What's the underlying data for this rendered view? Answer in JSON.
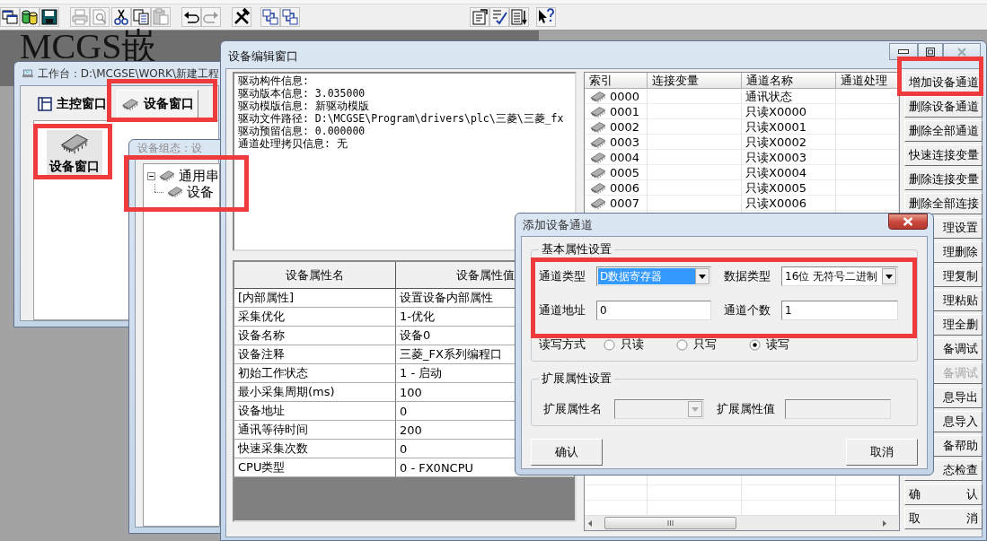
{
  "toolbar": [
    {
      "disabled": false
    },
    {
      "disabled": false
    },
    {
      "disabled": false
    },
    {
      "disabled": true
    },
    {
      "disabled": true
    },
    {
      "disabled": false
    },
    {
      "disabled": false
    },
    {
      "disabled": true
    },
    {
      "disabled": false
    },
    {
      "disabled": true
    },
    {
      "disabled": false
    },
    {
      "disabled": false
    },
    {
      "disabled": false
    },
    {
      "disabled": false
    },
    {
      "disabled": false
    },
    {
      "disabled": false
    },
    {
      "disabled": false
    }
  ],
  "banner": {
    "title": "MCGS嵌"
  },
  "workbench": {
    "title": "工作台：D:\\MCGSE\\WORK\\新建工程",
    "tabs": [
      {
        "label": "主控窗口",
        "selected": false
      },
      {
        "label": "设备窗口",
        "selected": true
      }
    ],
    "items": [
      {
        "label": "设备窗口",
        "selected": true
      }
    ]
  },
  "device_config_window": {
    "title": "设备组态：设",
    "tree": [
      {
        "label": "通用串",
        "expanded": true,
        "children": [
          {
            "label": "设备"
          }
        ]
      }
    ]
  },
  "device_edit_window": {
    "title": "设备编辑窗口",
    "info_lines": [
      "驱动构件信息:",
      "驱动版本信息: 3.035000",
      "驱动模版信息: 新驱动模版",
      "驱动文件路径: D:\\MCGSE\\Program\\drivers\\plc\\三菱\\三菱_fx",
      "驱动预留信息: 0.000000",
      "通道处理拷贝信息: 无"
    ],
    "properties": {
      "columns": [
        "设备属性名",
        "设备属性值"
      ],
      "rows": [
        [
          "[内部属性]",
          "设置设备内部属性"
        ],
        [
          "采集优化",
          "1-优化"
        ],
        [
          "设备名称",
          "设备0"
        ],
        [
          "设备注释",
          "三菱_FX系列编程口"
        ],
        [
          "初始工作状态",
          "1 - 启动"
        ],
        [
          "最小采集周期(ms)",
          "100"
        ],
        [
          "设备地址",
          "0"
        ],
        [
          "通讯等待时间",
          "200"
        ],
        [
          "快速采集次数",
          "0"
        ],
        [
          "CPU类型",
          "0 - FX0NCPU"
        ]
      ]
    },
    "channels": {
      "columns": [
        "索引",
        "连接变量",
        "通道名称",
        "通道处理"
      ],
      "rows": [
        {
          "index": "0000",
          "name": "通讯状态"
        },
        {
          "index": "0001",
          "name": "只读X0000"
        },
        {
          "index": "0002",
          "name": "只读X0001"
        },
        {
          "index": "0003",
          "name": "只读X0002"
        },
        {
          "index": "0004",
          "name": "只读X0003"
        },
        {
          "index": "0005",
          "name": "只读X0004"
        },
        {
          "index": "0006",
          "name": "只读X0005"
        },
        {
          "index": "0007",
          "name": "只读X0006"
        }
      ]
    },
    "buttons": [
      {
        "label": "增加设备通道",
        "kind": "full",
        "disabled": false
      },
      {
        "label": "删除设备通道",
        "kind": "full",
        "disabled": false
      },
      {
        "label": "删除全部通道",
        "kind": "full",
        "disabled": false
      },
      {
        "label": "快速连接变量",
        "kind": "full",
        "disabled": false
      },
      {
        "label": "删除连接变量",
        "kind": "full",
        "disabled": false
      },
      {
        "label": "删除全部连接",
        "kind": "full",
        "disabled": false
      },
      {
        "label": "理设置",
        "kind": "partial",
        "disabled": false
      },
      {
        "label": "理删除",
        "kind": "partial",
        "disabled": false
      },
      {
        "label": "理复制",
        "kind": "partial",
        "disabled": false
      },
      {
        "label": "理粘贴",
        "kind": "partial",
        "disabled": false
      },
      {
        "label": "理全删",
        "kind": "partial",
        "disabled": false
      },
      {
        "label": "备调试",
        "kind": "partial",
        "disabled": false
      },
      {
        "label": "备调试",
        "kind": "partial",
        "disabled": true
      },
      {
        "label": "息导出",
        "kind": "partial",
        "disabled": false
      },
      {
        "label": "息导入",
        "kind": "partial",
        "disabled": false
      },
      {
        "label": "备帮助",
        "kind": "partial",
        "disabled": false
      },
      {
        "label": "态检查",
        "kind": "partial",
        "disabled": false
      },
      {
        "label": "确 认",
        "kind": "spread",
        "disabled": false
      },
      {
        "label": "取 消",
        "kind": "spread",
        "disabled": false
      }
    ]
  },
  "add_channel_dialog": {
    "title": "添加设备通道",
    "basic_group": {
      "title": "基本属性设置",
      "channel_type": {
        "label": "通道类型",
        "value": "D数据寄存器",
        "focused": true
      },
      "data_type": {
        "label": "数据类型",
        "value": "16位 无符号二进制"
      },
      "channel_address": {
        "label": "通道地址",
        "value": "0"
      },
      "channel_count": {
        "label": "通道个数",
        "value": "1"
      },
      "access_mode": {
        "label": "读写方式",
        "options": [
          {
            "label": "只读",
            "selected": false
          },
          {
            "label": "只写",
            "selected": false
          },
          {
            "label": "读写",
            "selected": true
          }
        ]
      }
    },
    "extended_group": {
      "title": "扩展属性设置",
      "name_field": {
        "label": "扩展属性名",
        "disabled": true
      },
      "value_field": {
        "label": "扩展属性值",
        "disabled": true
      }
    },
    "buttons": [
      {
        "label": "确认"
      },
      {
        "label": "取消"
      }
    ]
  }
}
